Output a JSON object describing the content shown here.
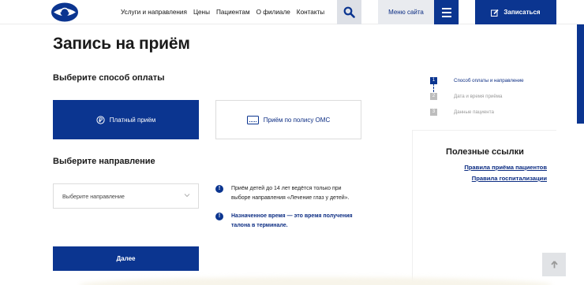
{
  "header": {
    "nav": [
      "Услуги и направления",
      "Цены",
      "Пациентам",
      "О филиале",
      "Контакты"
    ],
    "menu_label": "Меню сайта",
    "signup_label": "Записаться"
  },
  "main": {
    "title": "Запись на приём",
    "payment_title": "Выберите способ оплаты",
    "payment_options": [
      {
        "label": "Платный приём",
        "icon": "ruble-icon",
        "selected": true
      },
      {
        "label": "Приём по полису ОМС",
        "icon": "card-icon",
        "selected": false
      }
    ],
    "direction_title": "Выберите направление",
    "direction_placeholder": "Выберите направление",
    "info": [
      {
        "line1": "Приём детей до 14 лет ведётся только при",
        "line2": "выборе направления «Лечение глаз у детей»."
      },
      {
        "line1": "Назначенное время — это время получения",
        "line2": "талона в терминале."
      }
    ],
    "next_label": "Далее"
  },
  "steps": [
    {
      "num": "1",
      "label": "Способ оплаты и направление",
      "active": true
    },
    {
      "num": "2",
      "label": "Дата и время приёма",
      "active": false
    },
    {
      "num": "3",
      "label": "Данные пациента",
      "active": false
    }
  ],
  "useful_links": {
    "title": "Полезные ссылки",
    "links": [
      "Правила приёма пациентов",
      "Правила госпитализации"
    ]
  },
  "colors": {
    "brand": "#0b3590",
    "brand_text": "#0c2d83",
    "muted": "#bdbdbd"
  }
}
